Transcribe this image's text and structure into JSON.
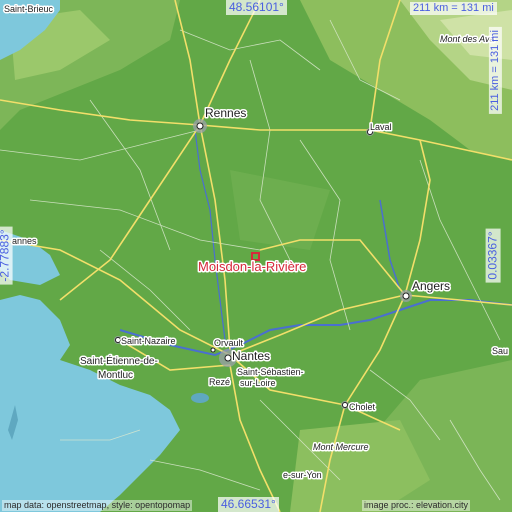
{
  "map": {
    "focus_place": "Moisdon-la-Rivière",
    "coordinates": {
      "lat_top": "48.56101°",
      "lat_bottom": "46.66531°",
      "lon_left": "-2.77883°",
      "lon_right": "0.03367°"
    },
    "scale": {
      "horizontal": "211 km = 131 mi",
      "vertical": "211 km = 131 mi"
    },
    "credits": {
      "left": "map data: openstreetmap, style: opentopomap",
      "right": "image proc.: elevation.city"
    },
    "places": {
      "saint_brieuc": "Saint-Brieuc",
      "rennes": "Rennes",
      "laval": "Laval",
      "mont_des_avaloirs": "Mont des Ava",
      "angers": "Angers",
      "saint_nazaire": "Saint-Nazaire",
      "saint_etienne_1": "Saint-Étienne-de-",
      "saint_etienne_2": "Montluc",
      "orvault": "Orvault",
      "nantes": "Nantes",
      "saint_sebastien_1": "Saint-Sébastien-",
      "saint_sebastien_2": "sur-Loire",
      "reze": "Rezé",
      "cholet": "Cholet",
      "mont_mercure": "Mont Mercure",
      "vannes": "annes",
      "saumur": "Sau",
      "la_roche_sur_yon": "e-sur-Yon"
    },
    "colors": {
      "lowland": "#62a847",
      "upland": "#8fc05f",
      "highland": "#b9d68a",
      "sea": "#7ec8dc",
      "motorway": "#f2df6a",
      "river": "#4a6fd0",
      "focus": "#d6283b",
      "coord_text": "#4a5fe0"
    }
  }
}
